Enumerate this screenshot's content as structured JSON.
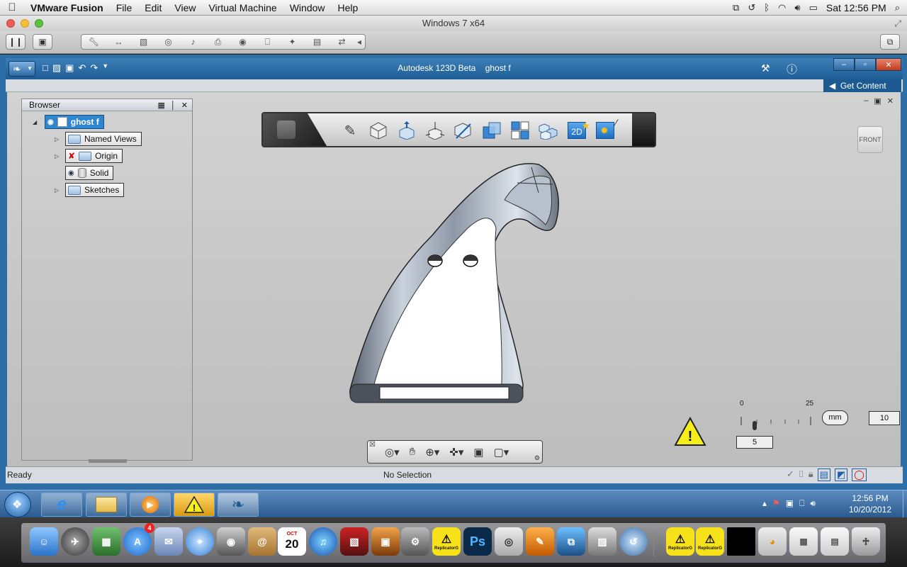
{
  "menubar": {
    "app": "VMware Fusion",
    "items": [
      "File",
      "Edit",
      "View",
      "Virtual Machine",
      "Window",
      "Help"
    ],
    "clock": "Sat 12:56 PM"
  },
  "vm": {
    "title": "Windows 7 x64"
  },
  "app": {
    "title": "Autodesk 123D Beta",
    "document": "ghost f",
    "get_content": "Get Content"
  },
  "browser": {
    "title": "Browser",
    "root": "ghost f",
    "nodes": [
      "Named Views",
      "Origin",
      "Solid",
      "Sketches"
    ]
  },
  "viewcube": {
    "label": "FRONT"
  },
  "mainbar": {
    "tools": [
      "sketch-icon",
      "box-icon",
      "extrude-icon",
      "move-icon",
      "section-icon",
      "combine-icon",
      "pattern-icon",
      "group-icon",
      "2d-drawing-icon",
      "render-icon"
    ],
    "drawing_label": "2D"
  },
  "scale": {
    "start": "0",
    "end": "25",
    "unit": "mm",
    "grid": "10",
    "value": "5"
  },
  "status": {
    "left": "Ready",
    "center": "No Selection"
  },
  "taskbar": {
    "time": "12:56 PM",
    "date": "10/20/2012"
  },
  "dock": {
    "calendar_month": "OCT",
    "calendar_day": "20",
    "ps_label": "Ps",
    "appstore_badge": "4",
    "replicator_label": "ReplicatorG"
  }
}
